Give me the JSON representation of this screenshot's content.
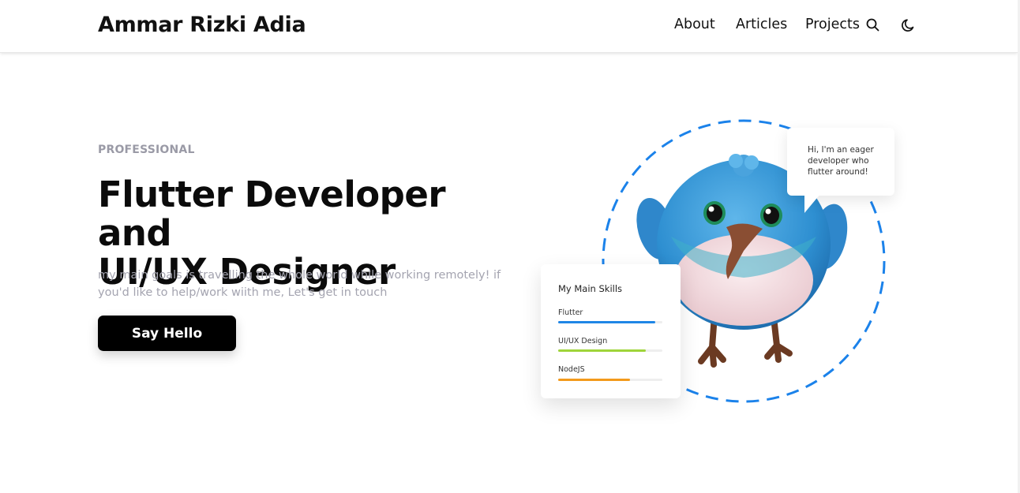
{
  "header": {
    "brand": "Ammar Rizki Adia",
    "nav": [
      {
        "label": "About"
      },
      {
        "label": "Articles"
      },
      {
        "label": "Projects"
      }
    ],
    "icons": [
      "search-icon",
      "moon-icon"
    ]
  },
  "hero": {
    "eyebrow": "PROFESSIONAL",
    "headline_line1": "Flutter Developer and",
    "headline_line2": "UI/UX Designer",
    "subtitle": "my main goals is travelling the whole world while working remotely! if you'd like to help/work wiith me, Let's get in touch",
    "cta_label": "Say Hello"
  },
  "speech_bubble": {
    "line1": "Hi, I'm an eager",
    "line2": "developer who",
    "line3": "flutter around!"
  },
  "skills": {
    "title": "My Main Skills",
    "items": [
      {
        "label": "Flutter",
        "level": 0.93,
        "color": "#1f86e6"
      },
      {
        "label": "UI/UX Design",
        "level": 0.84,
        "color": "#9fd43a"
      },
      {
        "label": "NodeJS",
        "level": 0.69,
        "color": "#f39a1c"
      }
    ]
  },
  "colors": {
    "ring": "#1b82ea",
    "cta_bg": "#000000",
    "eyebrow": "#9a9aa6"
  }
}
